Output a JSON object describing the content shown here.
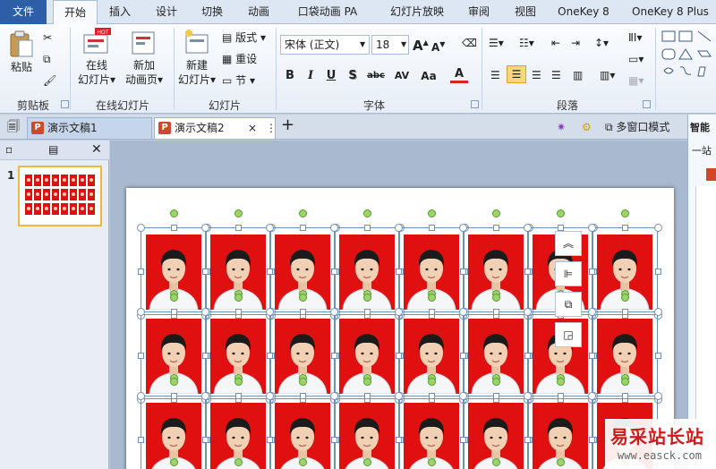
{
  "ribbon_tabs": [
    "文件",
    "开始",
    "插入",
    "设计",
    "切换",
    "动画",
    "口袋动画 PA",
    "幻灯片放映",
    "审阅",
    "视图",
    "OneKey 8",
    "OneKey 8 Plus"
  ],
  "groups": {
    "clipboard": {
      "label": "剪贴板",
      "paste": "粘贴"
    },
    "online": {
      "label": "在线幻灯片",
      "online_btn_l1": "在线",
      "online_btn_l2": "幻灯片",
      "hot_badge": "HOT",
      "new_btn_l1": "新加",
      "new_btn_l2": "动画页"
    },
    "slides": {
      "label": "幻灯片",
      "new_slide_l1": "新建",
      "new_slide_l2": "幻灯片",
      "layout": "版式",
      "reset": "重设",
      "section": "节"
    },
    "font": {
      "label": "字体",
      "font_name": "宋体 (正文)",
      "font_size": "18",
      "bold": "B",
      "italic": "I",
      "underline": "U",
      "shadow": "S",
      "strike": "abc",
      "spacing": "AV",
      "case": "Aa",
      "color": "A"
    },
    "paragraph": {
      "label": "段落"
    }
  },
  "doc_tabs": {
    "tab1": "演示文稿1",
    "tab2": "演示文稿2",
    "close": "×",
    "add": "+",
    "multi_window": "多窗口模式"
  },
  "right_pane": {
    "title": "智能",
    "subtitle": "一站"
  },
  "thumbnail": {
    "number": "1"
  },
  "watermark": {
    "line1": "易采站长站",
    "line2": "www.easck.com"
  },
  "photo_grid": {
    "rows": 3,
    "cols": 8
  }
}
